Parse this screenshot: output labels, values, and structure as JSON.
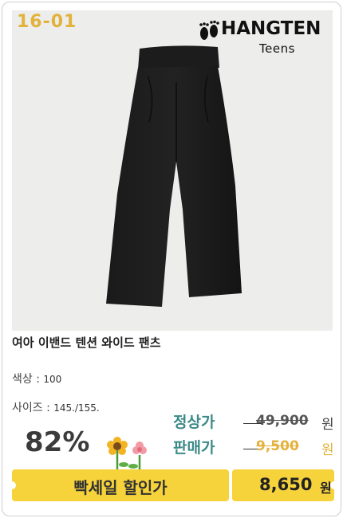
{
  "product": {
    "code": "16-01",
    "brand": {
      "name": "HANGTEN",
      "sub": "Teens"
    },
    "title": "여아 이밴드 텐션 와이드 팬츠",
    "color_label": "색상 : ",
    "color_value": "100",
    "size_label": "사이즈 : ",
    "size_value": "145./155."
  },
  "pricing": {
    "discount": "82%",
    "regular_label": "정상가",
    "regular_price": "49,900",
    "sale_label": "판매가",
    "sale_price": "9,500",
    "currency": "원",
    "banner_text": "빡세일 할인가",
    "final_price": "8,650",
    "final_currency": "원"
  },
  "colors": {
    "accent_yellow": "#f6d33a",
    "price_teal": "#3c8a88",
    "code_gold": "#e2b23b"
  },
  "icons": [
    "footprint-icon",
    "flowers-icon"
  ]
}
